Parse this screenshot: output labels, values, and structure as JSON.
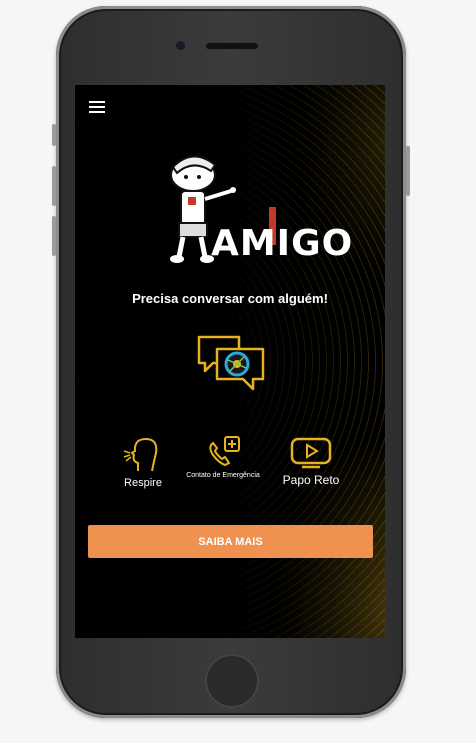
{
  "app": {
    "logo_text": "AMIGO"
  },
  "header": {
    "menu_icon": "hamburger-icon"
  },
  "hero": {
    "tagline": "Precisa conversar com alguém!"
  },
  "actions": [
    {
      "label": "Respire",
      "icon": "breathing-head-icon"
    },
    {
      "label": "Contato de Emergência",
      "icon": "phone-plus-icon"
    },
    {
      "label": "Papo Reto",
      "icon": "play-video-icon"
    }
  ],
  "cta": {
    "label": "SAIBA MAIS"
  },
  "colors": {
    "accent": "#f0924f",
    "icon_yellow": "#e8b21f",
    "screen_bg": "#000000"
  }
}
